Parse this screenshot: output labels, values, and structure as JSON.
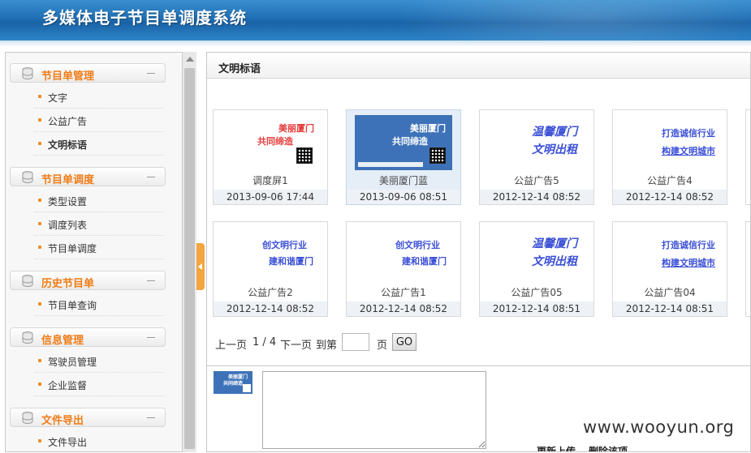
{
  "app": {
    "title": "多媒体电子节目单调度系统"
  },
  "sidebar": {
    "groups": [
      {
        "label": "节目单管理",
        "items": [
          {
            "label": "文字"
          },
          {
            "label": "公益广告"
          },
          {
            "label": "文明标语",
            "active": true
          }
        ]
      },
      {
        "label": "节目单调度",
        "items": [
          {
            "label": "类型设置"
          },
          {
            "label": "调度列表"
          },
          {
            "label": "节目单调度"
          }
        ]
      },
      {
        "label": "历史节目单",
        "items": [
          {
            "label": "节目单查询"
          }
        ]
      },
      {
        "label": "信息管理",
        "items": [
          {
            "label": "驾驶员管理"
          },
          {
            "label": "企业监督"
          }
        ]
      },
      {
        "label": "文件导出",
        "items": [
          {
            "label": "文件导出"
          }
        ]
      }
    ]
  },
  "main": {
    "title": "文明标语",
    "cards": [
      {
        "name": "调度屏1",
        "date": "2013-09-06 17:44",
        "line1": "美丽厦门",
        "line2": "共同缔造"
      },
      {
        "name": "美丽厦门蓝",
        "date": "2013-09-06 08:51",
        "line1": "美丽厦门",
        "line2": "共同缔造"
      },
      {
        "name": "公益广告5",
        "date": "2012-12-14 08:52",
        "line1": "温馨厦门",
        "line2": "文明出租"
      },
      {
        "name": "公益广告4",
        "date": "2012-12-14 08:52",
        "line1": "打造诚信行业",
        "line2": "构建文明城市"
      },
      {
        "name": "公益广告2",
        "date": "2012-12-14 08:52",
        "line1": "创文明行业",
        "line2": "建和谐厦门"
      },
      {
        "name": "公益广告1",
        "date": "2012-12-14 08:52",
        "line1": "创文明行业",
        "line2": "建和谐厦门"
      },
      {
        "name": "公益广告05",
        "date": "2012-12-14 08:51",
        "line1": "温馨厦门",
        "line2": "文明出租"
      },
      {
        "name": "公益广告04",
        "date": "2012-12-14 08:51",
        "line1": "打造诚信行业",
        "line2": "构建文明城市"
      }
    ],
    "pager": {
      "prev": "上一页",
      "info": "1 / 4",
      "next": "下一页",
      "goto": "到第",
      "page_value": "",
      "unit": "页",
      "go": "GO"
    },
    "edit": {
      "textarea_value": "",
      "update": "更新上传",
      "delete": "删除该项"
    }
  },
  "watermark": "www.wooyun.org",
  "colors": {
    "accent": "#f07d18",
    "header": "#1f6fb4"
  }
}
